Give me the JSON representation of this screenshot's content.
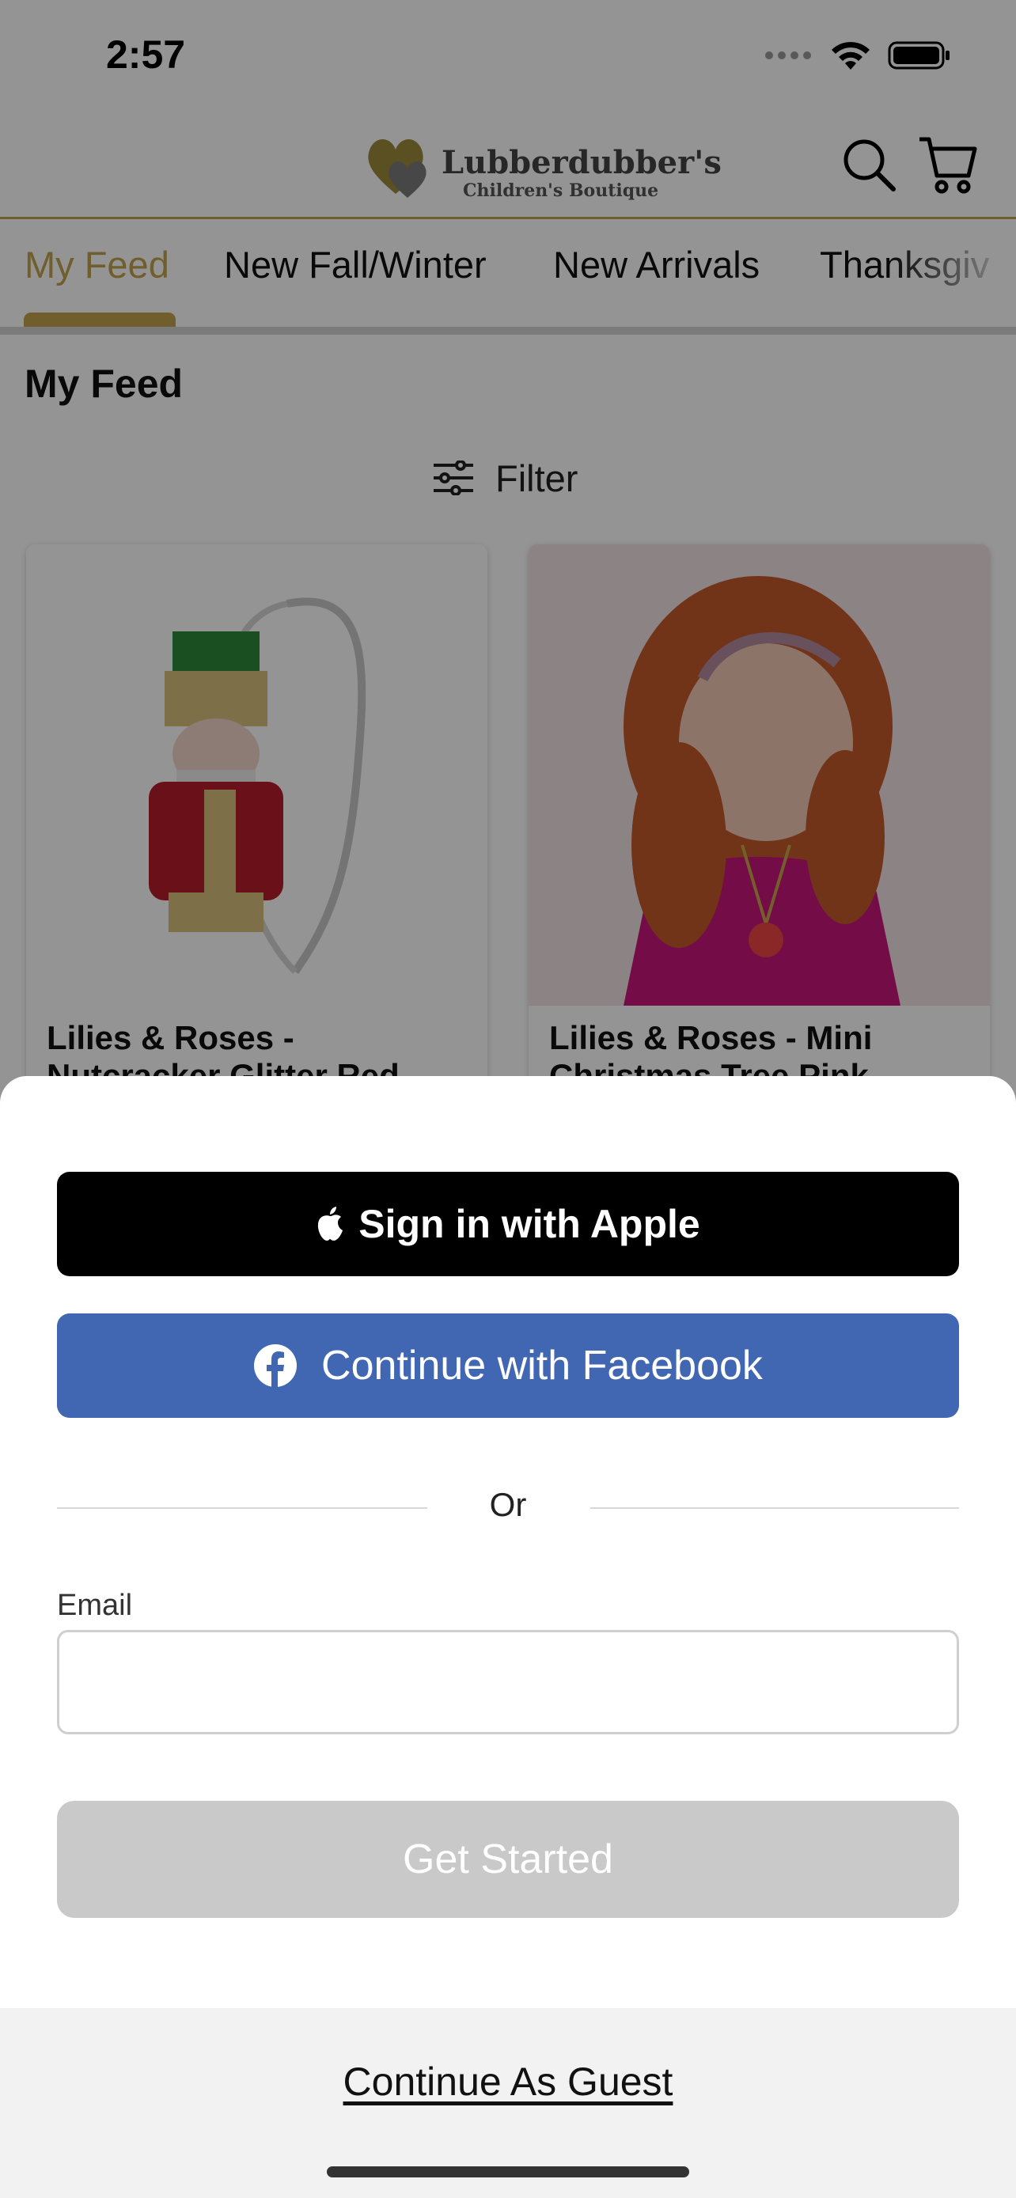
{
  "status_bar": {
    "time": "2:57"
  },
  "header": {
    "logo_line1": "Lubberdubber's",
    "logo_line2": "Children's Boutique",
    "search_icon": "search-icon",
    "cart_icon": "cart-icon"
  },
  "tabs": [
    {
      "label": "My Feed",
      "active": true
    },
    {
      "label": "New Fall/Winter",
      "active": false
    },
    {
      "label": "New Arrivals",
      "active": false
    },
    {
      "label": "Thanksgiv",
      "active": false
    }
  ],
  "feed": {
    "title": "My Feed",
    "filter_label": "Filter",
    "filter_icon": "sliders-icon",
    "products": [
      {
        "title": "Lilies & Roses - Nutcracker Glitter Red Headband"
      },
      {
        "title": "Lilies & Roses - Mini Christmas Tree Pink"
      }
    ]
  },
  "sheet": {
    "apple_label": "Sign in with Apple",
    "facebook_label": "Continue with Facebook",
    "or_text": "Or",
    "email_label": "Email",
    "email_value": "",
    "get_started_label": "Get Started",
    "guest_label": "Continue As Guest"
  },
  "colors": {
    "brand_gold": "#c2a24d",
    "facebook_blue": "#4267b2",
    "apple_black": "#000000",
    "disabled_gray": "#c9c9c9"
  }
}
